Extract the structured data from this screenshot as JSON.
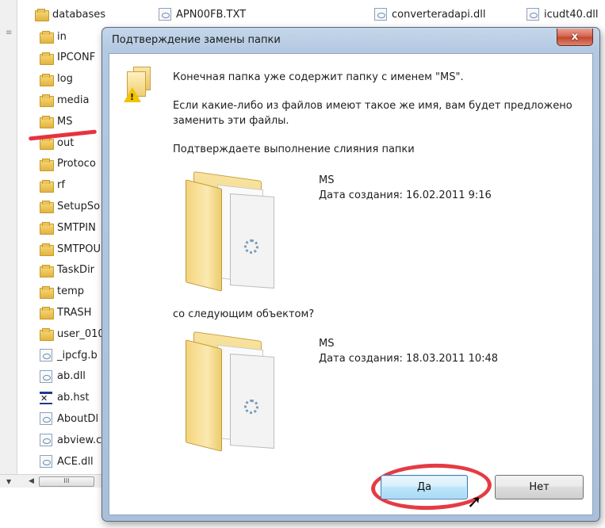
{
  "explorer": {
    "top_files": [
      {
        "label": "databases",
        "type": "folder"
      },
      {
        "label": "APN00FB.TXT",
        "type": "file"
      },
      {
        "label": "converteradapi.dll",
        "type": "file"
      },
      {
        "label": "icudt40.dll",
        "type": "file"
      }
    ],
    "files": [
      {
        "label": "in",
        "type": "folder"
      },
      {
        "label": "IPCONF",
        "type": "folder"
      },
      {
        "label": "log",
        "type": "folder"
      },
      {
        "label": "media",
        "type": "folder"
      },
      {
        "label": "MS",
        "type": "folder"
      },
      {
        "label": "out",
        "type": "folder"
      },
      {
        "label": "Protoco",
        "type": "folder"
      },
      {
        "label": "rf",
        "type": "folder"
      },
      {
        "label": "SetupSo",
        "type": "folder"
      },
      {
        "label": "SMTPIN",
        "type": "folder"
      },
      {
        "label": "SMTPOU",
        "type": "folder"
      },
      {
        "label": "TaskDir",
        "type": "folder"
      },
      {
        "label": "temp",
        "type": "folder"
      },
      {
        "label": "TRASH",
        "type": "folder"
      },
      {
        "label": "user_010",
        "type": "folder"
      },
      {
        "label": "_ipcfg.b",
        "type": "file"
      },
      {
        "label": "ab.dll",
        "type": "file"
      },
      {
        "label": "ab.hst",
        "type": "hst"
      },
      {
        "label": "AboutDl",
        "type": "file"
      },
      {
        "label": "abview.c",
        "type": "file"
      },
      {
        "label": "ACE.dll",
        "type": "file"
      }
    ],
    "scrollbar_thumb": "III"
  },
  "dialog": {
    "title": "Подтверждение замены папки",
    "close_label": "x",
    "message_line1": "Конечная папка уже содержит папку с именем \"MS\".",
    "message_line2a": "Если какие-либо из файлов имеют такое же имя, вам будет предложено",
    "message_line2b": "заменить эти файлы.",
    "message_line3": "Подтверждаете выполнение слияния папки",
    "existing": {
      "name": "MS",
      "date": "Дата создания: 16.02.2011 9:16"
    },
    "with_label": "со следующим объектом?",
    "incoming": {
      "name": "MS",
      "date": "Дата создания: 18.03.2011 10:48"
    },
    "yes_label": "Да",
    "no_label": "Нет"
  },
  "colors": {
    "annotation_red": "#e53b44",
    "titlebar_blue": "#b3c9e1",
    "close_red": "#c1452d"
  }
}
